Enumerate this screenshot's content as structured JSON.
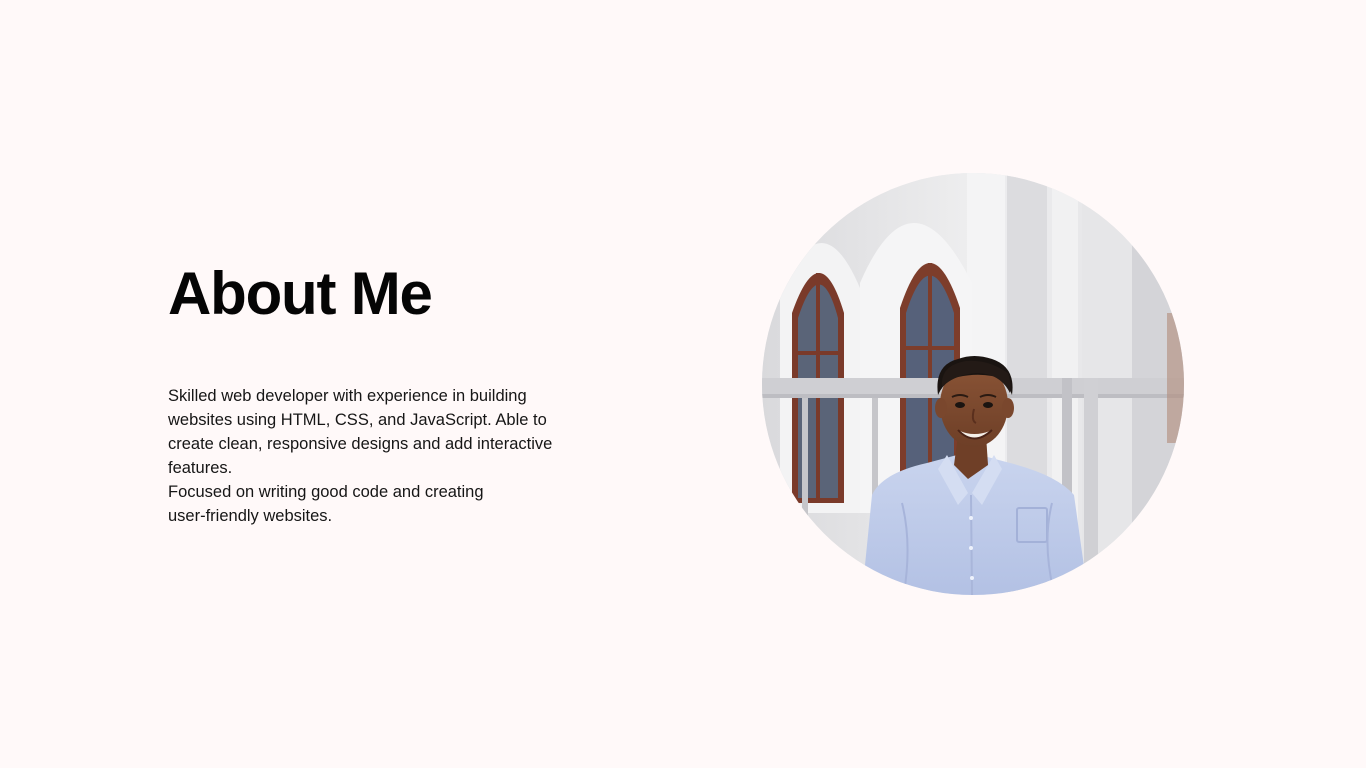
{
  "about": {
    "title": "About Me",
    "paragraphs": [
      "Skilled web developer with experience in building websites using HTML, CSS, and JavaScript. Able to create clean, responsive designs and add interactive features.",
      "Focused on writing good code and creating user-friendly websites."
    ]
  },
  "colors": {
    "background": "#fff9f9",
    "heading": "#050505",
    "body_text": "#161616"
  }
}
